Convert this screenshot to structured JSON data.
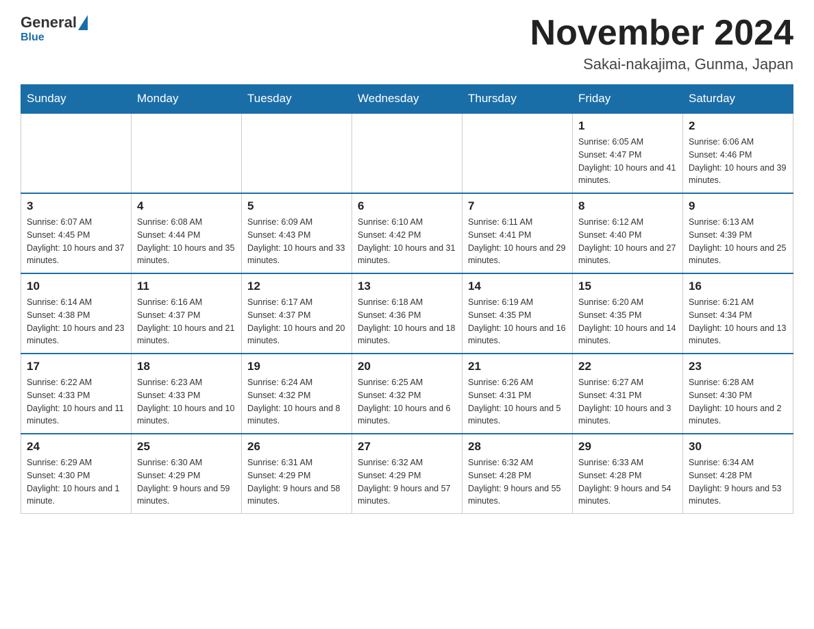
{
  "header": {
    "logo_general": "General",
    "logo_blue": "Blue",
    "month_title": "November 2024",
    "subtitle": "Sakai-nakajima, Gunma, Japan"
  },
  "weekdays": [
    "Sunday",
    "Monday",
    "Tuesday",
    "Wednesday",
    "Thursday",
    "Friday",
    "Saturday"
  ],
  "weeks": [
    [
      {
        "day": "",
        "info": ""
      },
      {
        "day": "",
        "info": ""
      },
      {
        "day": "",
        "info": ""
      },
      {
        "day": "",
        "info": ""
      },
      {
        "day": "",
        "info": ""
      },
      {
        "day": "1",
        "info": "Sunrise: 6:05 AM\nSunset: 4:47 PM\nDaylight: 10 hours and 41 minutes."
      },
      {
        "day": "2",
        "info": "Sunrise: 6:06 AM\nSunset: 4:46 PM\nDaylight: 10 hours and 39 minutes."
      }
    ],
    [
      {
        "day": "3",
        "info": "Sunrise: 6:07 AM\nSunset: 4:45 PM\nDaylight: 10 hours and 37 minutes."
      },
      {
        "day": "4",
        "info": "Sunrise: 6:08 AM\nSunset: 4:44 PM\nDaylight: 10 hours and 35 minutes."
      },
      {
        "day": "5",
        "info": "Sunrise: 6:09 AM\nSunset: 4:43 PM\nDaylight: 10 hours and 33 minutes."
      },
      {
        "day": "6",
        "info": "Sunrise: 6:10 AM\nSunset: 4:42 PM\nDaylight: 10 hours and 31 minutes."
      },
      {
        "day": "7",
        "info": "Sunrise: 6:11 AM\nSunset: 4:41 PM\nDaylight: 10 hours and 29 minutes."
      },
      {
        "day": "8",
        "info": "Sunrise: 6:12 AM\nSunset: 4:40 PM\nDaylight: 10 hours and 27 minutes."
      },
      {
        "day": "9",
        "info": "Sunrise: 6:13 AM\nSunset: 4:39 PM\nDaylight: 10 hours and 25 minutes."
      }
    ],
    [
      {
        "day": "10",
        "info": "Sunrise: 6:14 AM\nSunset: 4:38 PM\nDaylight: 10 hours and 23 minutes."
      },
      {
        "day": "11",
        "info": "Sunrise: 6:16 AM\nSunset: 4:37 PM\nDaylight: 10 hours and 21 minutes."
      },
      {
        "day": "12",
        "info": "Sunrise: 6:17 AM\nSunset: 4:37 PM\nDaylight: 10 hours and 20 minutes."
      },
      {
        "day": "13",
        "info": "Sunrise: 6:18 AM\nSunset: 4:36 PM\nDaylight: 10 hours and 18 minutes."
      },
      {
        "day": "14",
        "info": "Sunrise: 6:19 AM\nSunset: 4:35 PM\nDaylight: 10 hours and 16 minutes."
      },
      {
        "day": "15",
        "info": "Sunrise: 6:20 AM\nSunset: 4:35 PM\nDaylight: 10 hours and 14 minutes."
      },
      {
        "day": "16",
        "info": "Sunrise: 6:21 AM\nSunset: 4:34 PM\nDaylight: 10 hours and 13 minutes."
      }
    ],
    [
      {
        "day": "17",
        "info": "Sunrise: 6:22 AM\nSunset: 4:33 PM\nDaylight: 10 hours and 11 minutes."
      },
      {
        "day": "18",
        "info": "Sunrise: 6:23 AM\nSunset: 4:33 PM\nDaylight: 10 hours and 10 minutes."
      },
      {
        "day": "19",
        "info": "Sunrise: 6:24 AM\nSunset: 4:32 PM\nDaylight: 10 hours and 8 minutes."
      },
      {
        "day": "20",
        "info": "Sunrise: 6:25 AM\nSunset: 4:32 PM\nDaylight: 10 hours and 6 minutes."
      },
      {
        "day": "21",
        "info": "Sunrise: 6:26 AM\nSunset: 4:31 PM\nDaylight: 10 hours and 5 minutes."
      },
      {
        "day": "22",
        "info": "Sunrise: 6:27 AM\nSunset: 4:31 PM\nDaylight: 10 hours and 3 minutes."
      },
      {
        "day": "23",
        "info": "Sunrise: 6:28 AM\nSunset: 4:30 PM\nDaylight: 10 hours and 2 minutes."
      }
    ],
    [
      {
        "day": "24",
        "info": "Sunrise: 6:29 AM\nSunset: 4:30 PM\nDaylight: 10 hours and 1 minute."
      },
      {
        "day": "25",
        "info": "Sunrise: 6:30 AM\nSunset: 4:29 PM\nDaylight: 9 hours and 59 minutes."
      },
      {
        "day": "26",
        "info": "Sunrise: 6:31 AM\nSunset: 4:29 PM\nDaylight: 9 hours and 58 minutes."
      },
      {
        "day": "27",
        "info": "Sunrise: 6:32 AM\nSunset: 4:29 PM\nDaylight: 9 hours and 57 minutes."
      },
      {
        "day": "28",
        "info": "Sunrise: 6:32 AM\nSunset: 4:28 PM\nDaylight: 9 hours and 55 minutes."
      },
      {
        "day": "29",
        "info": "Sunrise: 6:33 AM\nSunset: 4:28 PM\nDaylight: 9 hours and 54 minutes."
      },
      {
        "day": "30",
        "info": "Sunrise: 6:34 AM\nSunset: 4:28 PM\nDaylight: 9 hours and 53 minutes."
      }
    ]
  ]
}
